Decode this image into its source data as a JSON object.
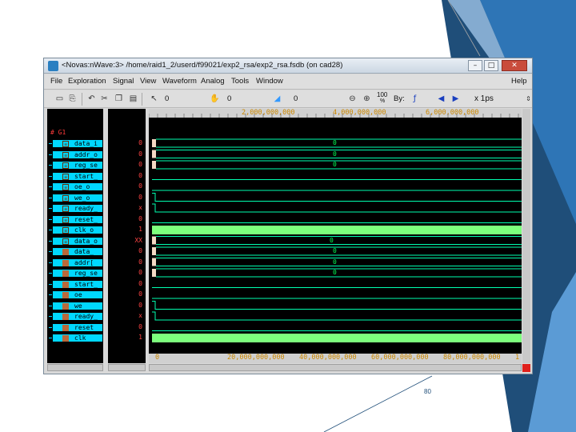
{
  "window": {
    "title": "<Novas:nWave:3> /home/raid1_2/userd/f99021/exp2_rsa/exp2_rsa.fsdb (on cad28)",
    "controls": {
      "minimize": "–",
      "maximize": "□",
      "close": "✕"
    }
  },
  "menu": [
    "File",
    "Exploration",
    "Signal",
    "View",
    "Waveform",
    "Analog",
    "Tools",
    "Window",
    "Help"
  ],
  "toolbar": {
    "cursor_time": "0",
    "marker_time": "0",
    "delta_time": "0",
    "zoom_level": "100",
    "zoom_unit": "%",
    "by_label": "By:",
    "time_unit": "x 1ps",
    "icons": [
      "open-icon",
      "save-icon",
      "undo-icon",
      "cut-icon",
      "copy-icon",
      "paste-icon",
      "cursor-icon",
      "marker-icon",
      "delta-icon",
      "zoom-out-icon",
      "zoom-in-icon",
      "zoom-fit-icon",
      "search-by-icon",
      "prev-arrow-icon",
      "next-arrow-icon"
    ]
  },
  "signals": {
    "group": "# G1",
    "items": [
      {
        "name": "data_i",
        "value": "0",
        "kind": "bus"
      },
      {
        "name": "addr_o",
        "value": "0",
        "kind": "bus"
      },
      {
        "name": "reg_se",
        "value": "0",
        "kind": "bus"
      },
      {
        "name": "start_",
        "value": "0",
        "kind": "bus"
      },
      {
        "name": "oe_o",
        "value": "0",
        "kind": "bus"
      },
      {
        "name": "we_o",
        "value": "0",
        "kind": "bus"
      },
      {
        "name": "ready_",
        "value": "x",
        "kind": "bus"
      },
      {
        "name": "reset_",
        "value": "0",
        "kind": "bus"
      },
      {
        "name": "clk_o",
        "value": "1",
        "kind": "bus"
      },
      {
        "name": "data_o",
        "value": "XX",
        "kind": "bus"
      },
      {
        "name": "data_",
        "value": "0",
        "kind": "sel"
      },
      {
        "name": "addr[",
        "value": "0",
        "kind": "sel"
      },
      {
        "name": "reg_se",
        "value": "0",
        "kind": "sel"
      },
      {
        "name": "start_",
        "value": "0",
        "kind": "sel"
      },
      {
        "name": "oe",
        "value": "0",
        "kind": "sel"
      },
      {
        "name": "we",
        "value": "0",
        "kind": "sel"
      },
      {
        "name": "ready_",
        "value": "x",
        "kind": "sel"
      },
      {
        "name": "reset",
        "value": "0",
        "kind": "sel"
      },
      {
        "name": "clk",
        "value": "1",
        "kind": "sel"
      }
    ]
  },
  "ruler_top": [
    "2,000,000,000",
    "4,000,000,000",
    "6,000,000,000"
  ],
  "ruler_bottom": [
    "0",
    "20,000,000,000",
    "40,000,000,000",
    "60,000,000,000",
    "80,000,000,000",
    "1"
  ],
  "wave_values": [
    "0",
    "0",
    "0",
    "0",
    "0",
    "0",
    "0"
  ],
  "colors": {
    "signal_bg": "#00d8ff",
    "value_text": "#ff4444",
    "wave_line": "#00ffb0",
    "clock_fill": "#7dff7d",
    "bus_fill": "#f3d9c4",
    "group_text": "#ff3b3b"
  },
  "page_number": "80"
}
